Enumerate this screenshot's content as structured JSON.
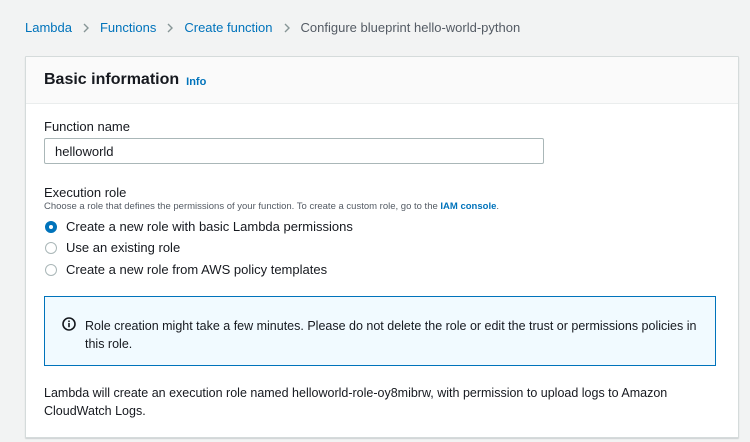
{
  "breadcrumb": {
    "items": [
      "Lambda",
      "Functions",
      "Create function"
    ],
    "current": "Configure blueprint hello-world-python"
  },
  "panel": {
    "title": "Basic information",
    "info_link": "Info"
  },
  "function_name": {
    "label": "Function name",
    "value": "helloworld"
  },
  "execution_role": {
    "label": "Execution role",
    "description": "Choose a role that defines the permissions of your function. To create a custom role, go to the",
    "description_link": "IAM console",
    "description_end": ".",
    "options": [
      {
        "label": "Create a new role with basic Lambda permissions",
        "selected": true
      },
      {
        "label": "Use an existing role",
        "selected": false
      },
      {
        "label": "Create a new role from AWS policy templates",
        "selected": false
      }
    ]
  },
  "alert": {
    "text": "Role creation might take a few minutes. Please do not delete the role or edit the trust or permissions policies in this role."
  },
  "footer": {
    "text": "Lambda will create an execution role named helloworld-role-oy8mibrw, with permission to upload logs to Amazon CloudWatch Logs."
  },
  "colors": {
    "link": "#0073bb",
    "alert_border": "#0073bb",
    "alert_bg": "#f1faff",
    "background": "#f2f3f3"
  },
  "icons": [
    "chevron-right-icon",
    "info-circle-icon"
  ]
}
